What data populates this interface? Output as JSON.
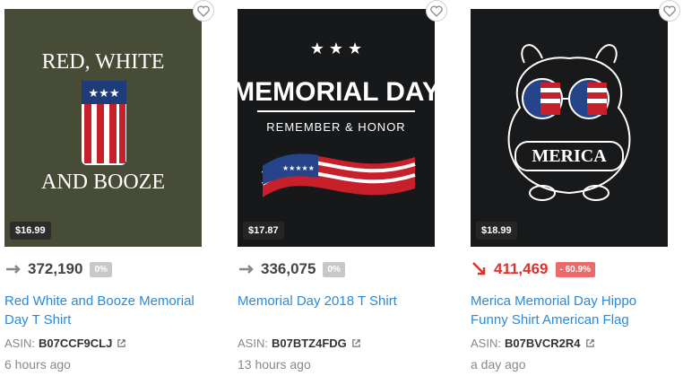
{
  "products": [
    {
      "price": "$16.99",
      "rank": "372,190",
      "trend": "flat",
      "change": "0%",
      "title": "Red White and Booze Memorial Day T Shirt",
      "asin_label": "ASIN:",
      "asin": "B07CCF9CLJ",
      "time": "6 hours ago",
      "art": {
        "line1": "RED, WHITE",
        "line2": "AND BOOZE",
        "bg": "#474c36"
      }
    },
    {
      "price": "$17.87",
      "rank": "336,075",
      "trend": "flat",
      "change": "0%",
      "title": "Memorial Day 2018 T Shirt",
      "asin_label": "ASIN:",
      "asin": "B07BTZ4FDG",
      "time": "13 hours ago",
      "art": {
        "line1": "MEMORIAL DAY",
        "line2": "REMEMBER & HONOR",
        "bg": "#16181a"
      }
    },
    {
      "price": "$18.99",
      "rank": "411,469",
      "trend": "down",
      "change": "- 60.9%",
      "title": "Merica Memorial Day Hippo Funny Shirt American Flag",
      "asin_label": "ASIN:",
      "asin": "B07BVCR2R4",
      "time": "a day ago",
      "art": {
        "line1": "MERICA",
        "bg": "#17191b"
      }
    }
  ],
  "colors": {
    "link": "#2a8ad8",
    "down": "#e0302b",
    "neutral_badge": "#c8c8c8",
    "red_badge": "#ec6a6a"
  },
  "icons": {
    "heart": "heart-icon",
    "trend_flat": "arrow-right-icon",
    "trend_down": "arrow-down-right-icon",
    "external": "external-link-icon"
  }
}
